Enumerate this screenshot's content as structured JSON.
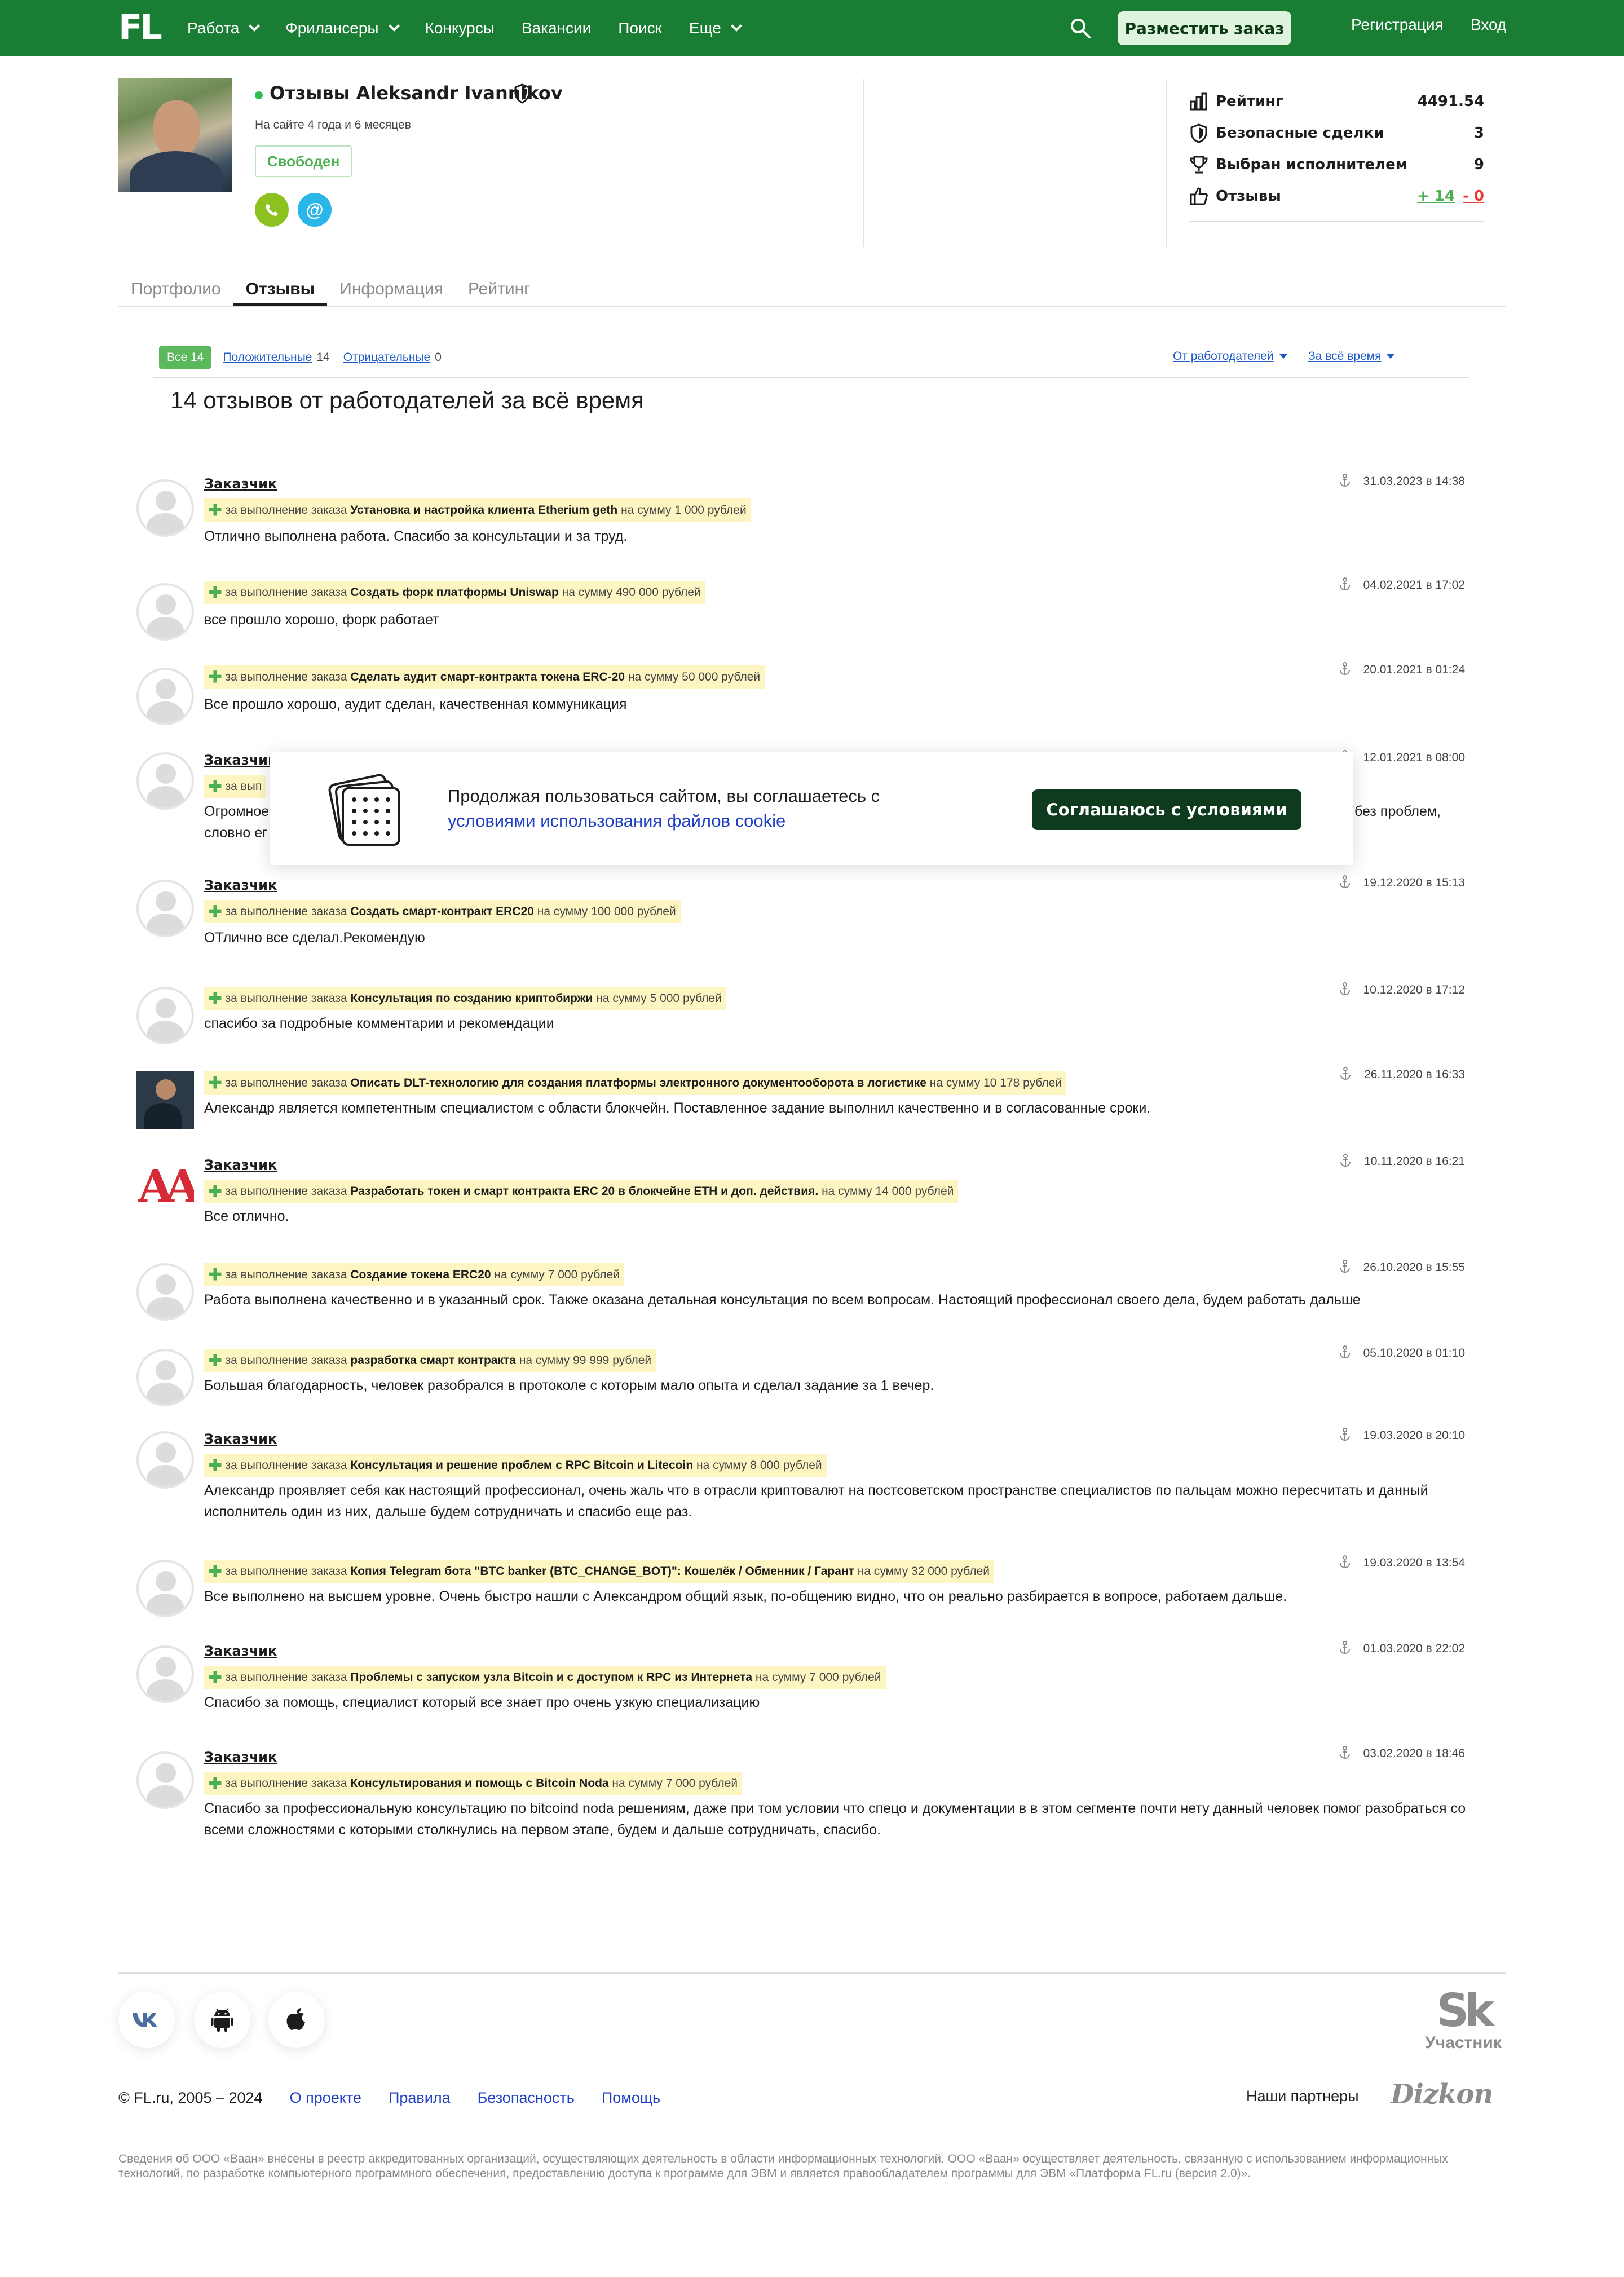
{
  "header": {
    "logo": "FL",
    "nav": [
      {
        "label": "Работа",
        "dropdown": true
      },
      {
        "label": "Фрилансеры",
        "dropdown": true
      },
      {
        "label": "Конкурсы",
        "dropdown": false
      },
      {
        "label": "Вакансии",
        "dropdown": false
      },
      {
        "label": "Поиск",
        "dropdown": false
      },
      {
        "label": "Еще",
        "dropdown": true
      }
    ],
    "post_button": "Разместить заказ",
    "register": "Регистрация",
    "login": "Вход",
    "colors": {
      "brand": "#1a7d34",
      "post_button_bg": "#dff3de"
    }
  },
  "profile": {
    "name": "Отзывы Aleksandr Ivannikov",
    "since": "На сайте 4 года и 6 месяцев",
    "status": "Свободен",
    "contacts": [
      {
        "icon": "phone-icon",
        "color": "#8bc220"
      },
      {
        "icon": "at-icon",
        "color": "#29b6e8"
      }
    ]
  },
  "stats": {
    "rating_label": "Рейтинг",
    "rating_value": "4491.54",
    "deals_label": "Безопасные сделки",
    "deals_value": "3",
    "chosen_label": "Выбран исполнителем",
    "chosen_value": "9",
    "reviews_label": "Отзывы",
    "reviews_pos": "+ 14",
    "reviews_neg": "- 0"
  },
  "tabs": [
    "Портфолио",
    "Отзывы",
    "Информация",
    "Рейтинг"
  ],
  "active_tab": "Отзывы",
  "filters": {
    "all": "Все 14",
    "positive_label": "Положительные",
    "positive_count": "14",
    "negative_label": "Отрицательные",
    "negative_count": "0",
    "from": "От работодателей",
    "period": "За всё время"
  },
  "summary": "14 отзывов от работодателей за всё время",
  "reviews": [
    {
      "author": "Заказчик",
      "avatar": "placeholder",
      "date": "31.03.2023 в 14:38",
      "prefix": "за выполнение заказа",
      "project": "Установка и настройка клиента Etherium geth",
      "sum": "на сумму 1 000 рублей",
      "text": "Отлично  выполнена работа.  Спасибо за консультации и за труд."
    },
    {
      "author": "",
      "avatar": "placeholder",
      "date": "04.02.2021 в 17:02",
      "prefix": "за выполнение заказа",
      "project": "Создать форк платформы Uniswap",
      "sum": "на сумму 490 000 рублей",
      "text": "все прошло хорошо, форк работает"
    },
    {
      "author": "",
      "avatar": "placeholder",
      "date": "20.01.2021 в 01:24",
      "prefix": "за выполнение заказа",
      "project": "Сделать аудит смарт-контракта токена ERC-20",
      "sum": "на сумму 50 000 рублей",
      "text": "Все прошло хорошо, аудит сделан, качественная коммуникация"
    },
    {
      "author": "Заказчик",
      "avatar": "placeholder",
      "date": "12.01.2021 в 08:00",
      "prefix": "за вып",
      "project": "",
      "sum": "",
      "text": "Огромное",
      "text_right": "без проблем,",
      "text2": "словно ег"
    },
    {
      "author": "Заказчик",
      "avatar": "placeholder",
      "date": "19.12.2020 в 15:13",
      "prefix": "за выполнение заказа",
      "project": "Создать смарт-контракт ERC20",
      "sum": "на сумму 100 000 рублей",
      "text": "ОТлично все сделал.Рекомендую"
    },
    {
      "author": "",
      "avatar": "placeholder",
      "date": "10.12.2020 в 17:12",
      "prefix": "за выполнение заказа",
      "project": "Консультация по созданию криптобиржи",
      "sum": "на сумму 5 000 рублей",
      "text": "спасибо за подробные комментарии и рекомендации"
    },
    {
      "author": "",
      "avatar": "photo",
      "date": "26.11.2020 в 16:33",
      "prefix": "за выполнение заказа",
      "project": "Описать DLT-технологию для создания платформы электронного документооборота в логистике",
      "sum": "на сумму 10 178 рублей",
      "text": "Александр является компетентным специалистом с области блокчейн. Поставленное задание выполнил качественно и в согласованные сроки."
    },
    {
      "author": "Заказчик",
      "avatar": "mm",
      "avatar_text": "AA",
      "date": "10.11.2020 в 16:21",
      "prefix": "за выполнение заказа",
      "project": "Разработать токен и смарт контракта ERC 20 в блокчейне ETH и доп. действия.",
      "sum": "на сумму 14 000 рублей",
      "text": "Все отлично."
    },
    {
      "author": "",
      "avatar": "placeholder",
      "date": "26.10.2020 в 15:55",
      "prefix": "за выполнение заказа",
      "project": "Создание токена ERC20",
      "sum": "на сумму 7 000 рублей",
      "text": "Работа выполнена качественно и в указанный срок. Также оказана детальная консультация по всем вопросам. Настоящий профессионал своего дела, будем работать дальше"
    },
    {
      "author": "",
      "avatar": "placeholder",
      "date": "05.10.2020 в 01:10",
      "prefix": "за выполнение заказа",
      "project": "разработка смарт контракта",
      "sum": "на сумму 99 999 рублей",
      "text": "Большая благодарность, человек разобрался в протоколе с которым мало опыта и сделал задание за 1 вечер."
    },
    {
      "author": "Заказчик",
      "avatar": "placeholder",
      "date": "19.03.2020 в 20:10",
      "prefix": "за выполнение заказа",
      "project": "Консультация и решение проблем с RPC Bitcoin и Litecoin",
      "sum": "на сумму 8 000 рублей",
      "text": "Александр проявляет себя как настоящий профессионал, очень жаль что в отрасли криптовалют на постсоветском пространстве специалистов по пальцам можно пересчитать и данный исполнитель один из них, дальше будем сотрудничать и спасибо еще раз."
    },
    {
      "author": "",
      "avatar": "placeholder",
      "date": "19.03.2020 в 13:54",
      "prefix": "за выполнение заказа",
      "project": "Копия Telegram бота \"BTC banker (BTC_CHANGE_BOT)\": Кошелёк / Обменник / Гарант",
      "sum": "на сумму 32 000 рублей",
      "text": "Все выполнено на высшем уровне. Очень быстро нашли с Александром общий язык, по-общению видно, что он реально разбирается в вопросе, работаем дальше."
    },
    {
      "author": "Заказчик",
      "avatar": "placeholder",
      "date": "01.03.2020 в 22:02",
      "prefix": "за выполнение заказа",
      "project": "Проблемы с запуском узла Bitcoin и с доступом к RPC из Интернета",
      "sum": "на сумму 7 000 рублей",
      "text": "Спасибо за помощь, специалист который все знает про очень узкую специализацию"
    },
    {
      "author": "Заказчик",
      "avatar": "placeholder",
      "date": "03.02.2020 в 18:46",
      "prefix": "за выполнение заказа",
      "project": "Консультирования и помощь с Bitcoin Noda",
      "sum": "на сумму 7 000 рублей",
      "text": "Спасибо за профессиональную консультацию по bitcoind noda решениям, даже при том условии что спецо и документации в в этом сегменте почти нету данный человек помог разобраться со всеми сложностями с которыми столкнулись на первом этапе, будем и дальше сотрудничать, спасибо."
    }
  ],
  "cookie": {
    "text": "Продолжая пользоваться сайтом, вы соглашаетесь с",
    "link": "условиями использования файлов cookie",
    "button": "Соглашаюсь с условиями"
  },
  "footer": {
    "social": [
      "vk-icon",
      "android-icon",
      "apple-icon"
    ],
    "skolkovo_big": "Sk",
    "skolkovo_small": "Участник",
    "copyright": "© FL.ru, 2005 – 2024",
    "links": [
      "О проекте",
      "Правила",
      "Безопасность",
      "Помощь"
    ],
    "partners": "Наши партнеры",
    "partner_name": "Dizkon",
    "legal": "Сведения об ООО «Ваан» внесены в реестр аккредитованных организаций, осуществляющих деятельность в области информационных технологий. ООО «Ваан» осуществляет деятельность, связанную с использованием информационных технологий, по разработке компьютерного программного обеспечения, предоставлению доступа к программе для ЭВМ и является правообладателем программы для ЭВМ «Платформа FL.ru (версия 2.0)»."
  }
}
